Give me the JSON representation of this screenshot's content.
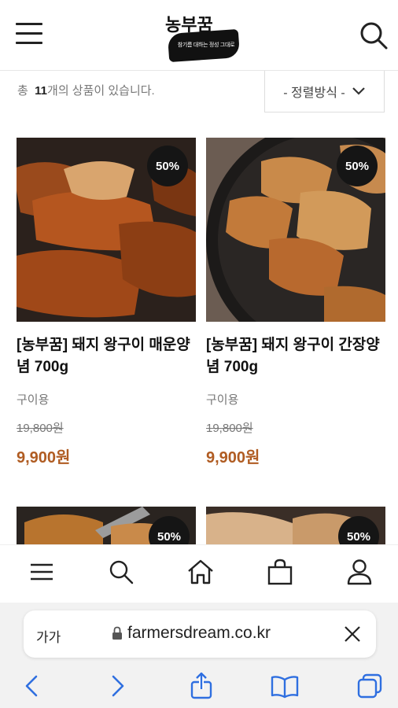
{
  "header": {
    "logo_text": "농부꿈",
    "logo_slogan": "참기름 대하는 정성 그대로"
  },
  "toolbar": {
    "count_prefix": "총",
    "count_value": "11",
    "count_suffix": "개의 상품이 있습니다.",
    "sort_label": "- 정렬방식 -"
  },
  "products": [
    {
      "name": "[농부꿈] 돼지 왕구이 매운양념 700g",
      "tag": "구이용",
      "original_price": "19,800원",
      "sale_price": "9,900원",
      "badge": "50%"
    },
    {
      "name": "[농부꿈] 돼지 왕구이 간장양념 700g",
      "tag": "구이용",
      "original_price": "19,800원",
      "sale_price": "9,900원",
      "badge": "50%"
    },
    {
      "badge": "50%"
    },
    {
      "badge": "50%"
    }
  ],
  "tabbar": {
    "items": [
      {
        "icon": "menu-icon"
      },
      {
        "icon": "search-icon"
      },
      {
        "icon": "home-icon"
      },
      {
        "icon": "bag-icon"
      },
      {
        "icon": "user-icon"
      }
    ]
  },
  "browser": {
    "text_size_label": "가가",
    "url": "farmersdream.co.kr"
  },
  "colors": {
    "sale_price": "#b05c22",
    "badge": "#151515"
  }
}
